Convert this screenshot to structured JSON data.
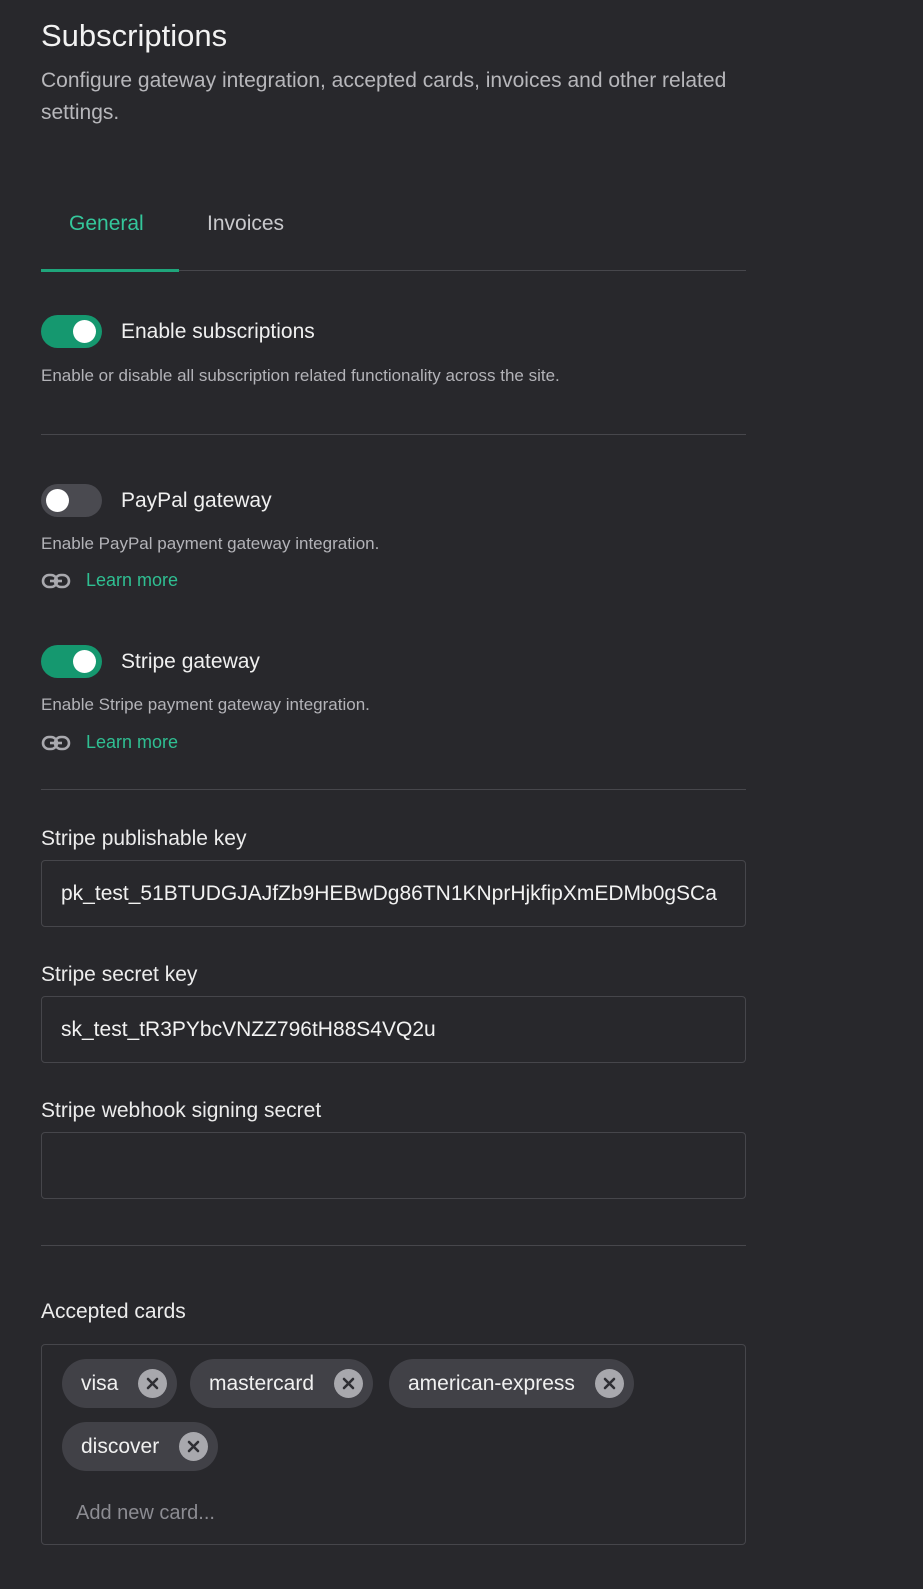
{
  "header": {
    "title": "Subscriptions",
    "subtitle": "Configure gateway integration, accepted cards, invoices and other related settings."
  },
  "tabs": [
    {
      "label": "General",
      "active": true
    },
    {
      "label": "Invoices",
      "active": false
    }
  ],
  "settings": {
    "enable_subscriptions": {
      "label": "Enable subscriptions",
      "description": "Enable or disable all subscription related functionality across the site.",
      "enabled": true
    },
    "paypal": {
      "label": "PayPal gateway",
      "description": "Enable PayPal payment gateway integration.",
      "link": "Learn more",
      "enabled": false
    },
    "stripe": {
      "label": "Stripe gateway",
      "description": "Enable Stripe payment gateway integration.",
      "link": "Learn more",
      "enabled": true
    }
  },
  "fields": {
    "publishable_key": {
      "label": "Stripe publishable key",
      "value": "pk_test_51BTUDGJAJfZb9HEBwDg86TN1KNprHjkfipXmEDMb0gSCa"
    },
    "secret_key": {
      "label": "Stripe secret key",
      "value": "sk_test_tR3PYbcVNZZ796tH88S4VQ2u"
    },
    "webhook_secret": {
      "label": "Stripe webhook signing secret",
      "value": ""
    }
  },
  "accepted_cards": {
    "label": "Accepted cards",
    "cards": [
      "visa",
      "mastercard",
      "american-express",
      "discover"
    ],
    "placeholder": "Add new card..."
  },
  "colors": {
    "background": "#28282c",
    "accent": "#1fa57b",
    "link": "#2fbf92"
  },
  "icons": {
    "link": "link-icon",
    "remove": "close-circle-icon"
  }
}
